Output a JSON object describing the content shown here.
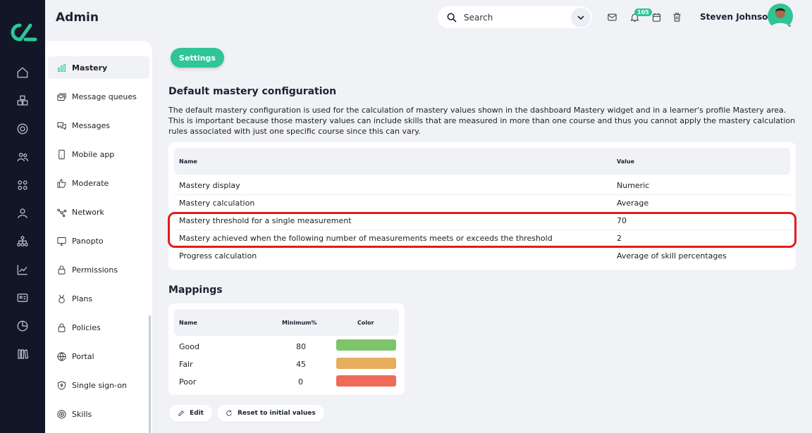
{
  "header": {
    "title": "Admin",
    "search_placeholder": "Search",
    "notification_count": "105",
    "user_name": "Steven Johnson"
  },
  "rail_icons": [
    "home-icon",
    "cubes-icon",
    "target-icon",
    "users-icon",
    "apps-icon",
    "user-icon",
    "hierarchy-icon",
    "chart-icon",
    "id-card-icon",
    "pie-icon",
    "books-icon"
  ],
  "sidebar": {
    "items": [
      {
        "label": "Mastery",
        "icon": "bar-chart-icon",
        "active": true
      },
      {
        "label": "Message queues",
        "icon": "message-queue-icon"
      },
      {
        "label": "Messages",
        "icon": "chat-icon"
      },
      {
        "label": "Mobile app",
        "icon": "mobile-icon"
      },
      {
        "label": "Moderate",
        "icon": "thumbs-up-icon"
      },
      {
        "label": "Network",
        "icon": "network-icon"
      },
      {
        "label": "Panopto",
        "icon": "monitor-icon"
      },
      {
        "label": "Permissions",
        "icon": "lock-icon"
      },
      {
        "label": "Plans",
        "icon": "medal-icon"
      },
      {
        "label": "Policies",
        "icon": "lock-icon"
      },
      {
        "label": "Portal",
        "icon": "globe-icon"
      },
      {
        "label": "Single sign-on",
        "icon": "shield-icon"
      },
      {
        "label": "Skills",
        "icon": "target-icon"
      }
    ]
  },
  "main": {
    "settings_label": "Settings",
    "config_title": "Default mastery configuration",
    "config_description": "The default mastery configuration is used for the calculation of mastery values shown in the dashboard Mastery widget and in a learner's profile Mastery area. This is important because those mastery values can include skills that are measured in more than one course and thus you cannot apply the mastery calculation rules associated with just one specific course since this can vary.",
    "config_table": {
      "headers": {
        "name": "Name",
        "value": "Value"
      },
      "rows": [
        {
          "name": "Mastery display",
          "value": "Numeric"
        },
        {
          "name": "Mastery calculation",
          "value": "Average"
        },
        {
          "name": "Mastery threshold for a single measurement",
          "value": "70"
        },
        {
          "name": "Mastery achieved when the following number of measurements meets or exceeds the threshold",
          "value": "2"
        },
        {
          "name": "Progress calculation",
          "value": "Average of skill percentages"
        }
      ]
    },
    "mappings_title": "Mappings",
    "mappings_table": {
      "headers": {
        "name": "Name",
        "minimum": "Minimum%",
        "color": "Color"
      },
      "rows": [
        {
          "name": "Good",
          "minimum": "80",
          "color": "#7ec46a"
        },
        {
          "name": "Fair",
          "minimum": "45",
          "color": "#e6ad5c"
        },
        {
          "name": "Poor",
          "minimum": "0",
          "color": "#ef6a58"
        }
      ]
    },
    "edit_label": "Edit",
    "reset_label": "Reset to initial values"
  },
  "colors": {
    "accent": "#2fc596",
    "rail": "#121727",
    "highlight": "#e01c1c"
  }
}
